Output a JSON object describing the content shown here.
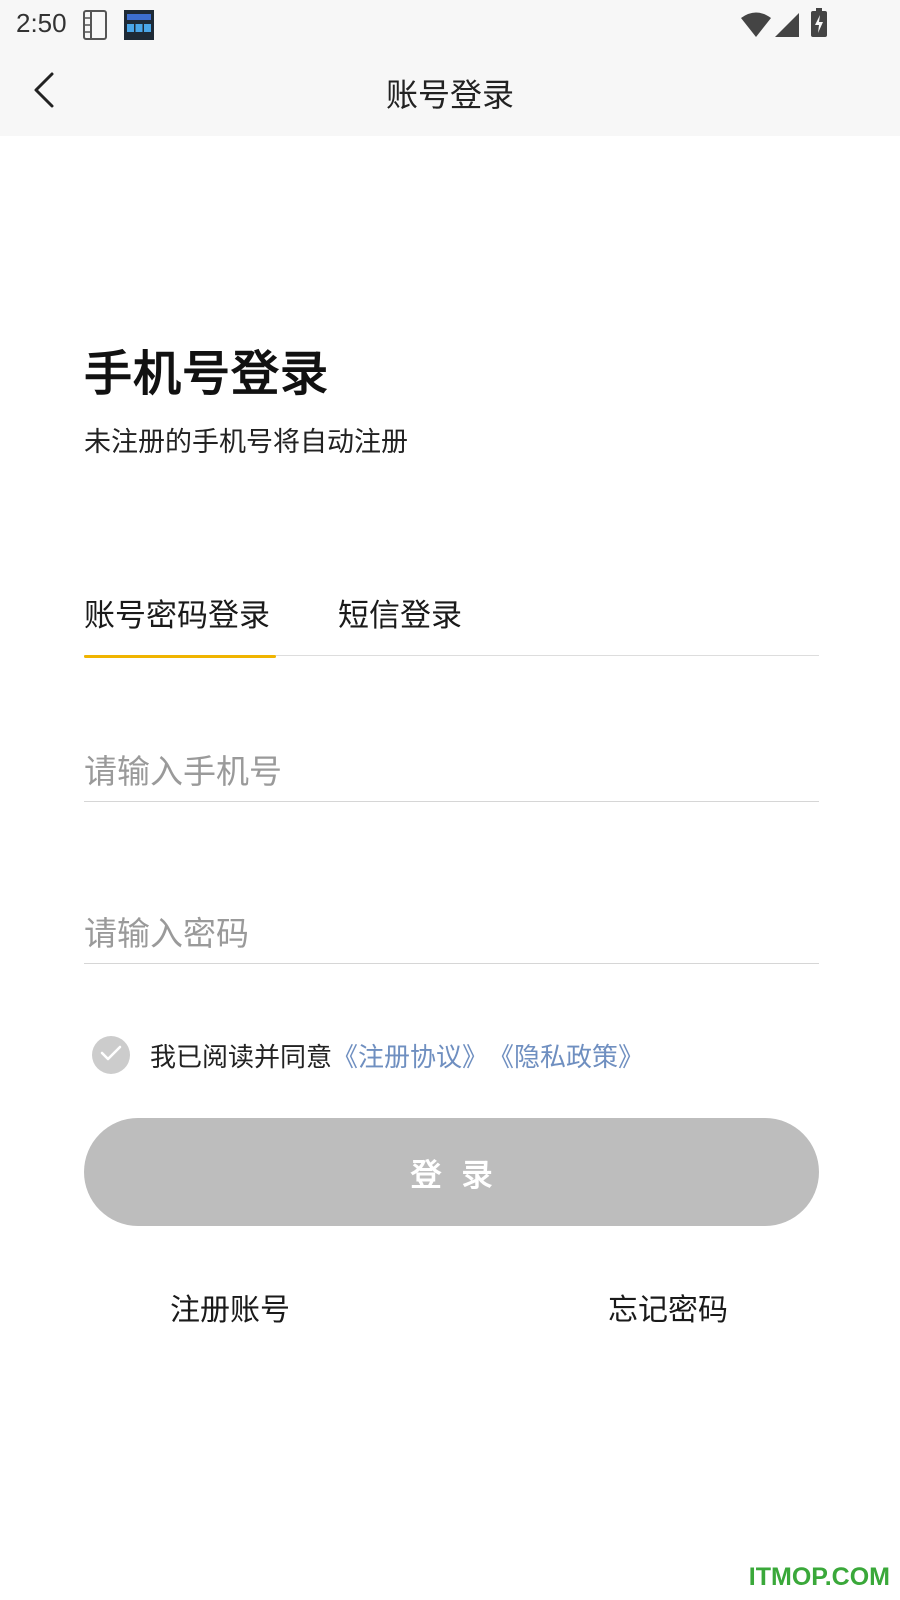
{
  "status_bar": {
    "time": "2:50",
    "icons": [
      "sim-card-icon",
      "app-notification-icon",
      "wifi-icon",
      "cell-signal-icon",
      "battery-charging-icon"
    ]
  },
  "nav": {
    "title": "账号登录",
    "back_icon": "chevron-left-icon"
  },
  "login": {
    "headline": "手机号登录",
    "subtitle": "未注册的手机号将自动注册",
    "tabs": [
      {
        "label": "账号密码登录",
        "active": true
      },
      {
        "label": "短信登录",
        "active": false
      }
    ],
    "phone_placeholder": "请输入手机号",
    "phone_value": "",
    "password_placeholder": "请输入密码",
    "password_value": "",
    "agreement": {
      "text": "我已阅读并同意",
      "terms_link": "《注册协议》",
      "privacy_link": "《隐私政策》"
    },
    "login_button": "登录",
    "register_link": "注册账号",
    "forgot_link": "忘记密码"
  },
  "watermark": "ITMOP.COM",
  "colors": {
    "accent_underline": "#f0b400",
    "link": "#6f8fc0",
    "button_disabled": "#bdbdbd",
    "watermark": "#3aa83a"
  }
}
